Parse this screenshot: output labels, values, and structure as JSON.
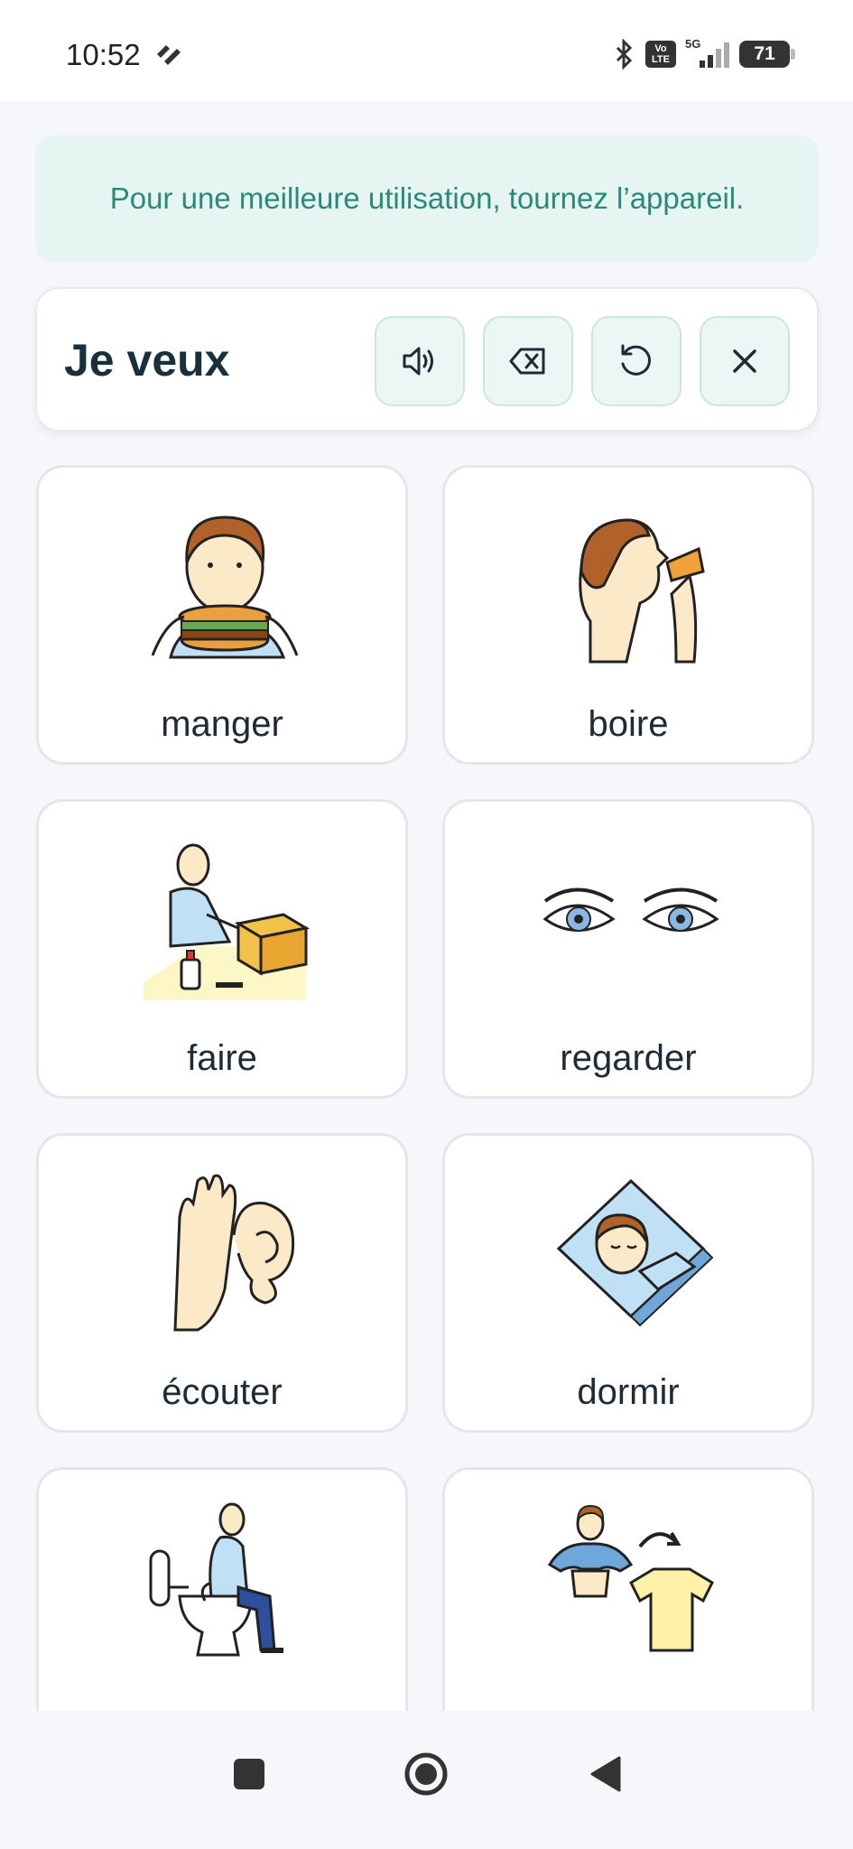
{
  "status_bar": {
    "time": "10:52",
    "network": "5G",
    "volte_top": "Vo",
    "volte_bottom": "LTE",
    "battery": "71"
  },
  "banner": {
    "text": "Pour une meilleure utilisation, tournez l’appareil."
  },
  "phrase_bar": {
    "text": "Je veux",
    "buttons": [
      "speaker-icon",
      "backspace-icon",
      "undo-icon",
      "close-icon"
    ]
  },
  "cards": [
    {
      "label": "manger",
      "icon": "eating-burger-pictogram"
    },
    {
      "label": "boire",
      "icon": "drinking-glass-pictogram"
    },
    {
      "label": "faire",
      "icon": "making-box-pictogram"
    },
    {
      "label": "regarder",
      "icon": "eyes-pictogram"
    },
    {
      "label": "écouter",
      "icon": "ear-pictogram"
    },
    {
      "label": "dormir",
      "icon": "sleeping-pictogram"
    },
    {
      "label": "",
      "icon": "toilet-pictogram"
    },
    {
      "label": "",
      "icon": "undress-shirt-pictogram"
    }
  ],
  "colors": {
    "accent": "#2a8a7a",
    "banner_bg": "#e6f5f2",
    "button_bg": "#ecf7f5",
    "page_bg": "#f5f7fb"
  }
}
